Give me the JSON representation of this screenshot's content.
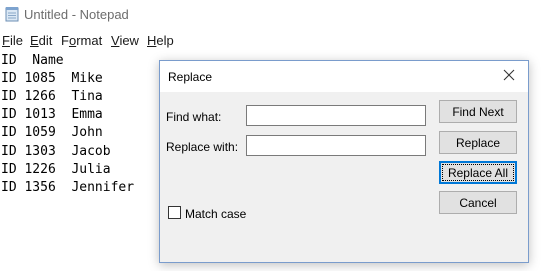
{
  "window": {
    "title": "Untitled - Notepad"
  },
  "menu": {
    "items": [
      "File",
      "Edit",
      "Format",
      "View",
      "Help"
    ],
    "access_keys": [
      "F",
      "E",
      "o",
      "V",
      "H"
    ]
  },
  "editor": {
    "lines": [
      "ID  Name",
      "ID 1085  Mike",
      "ID 1266  Tina",
      "ID 1013  Emma",
      "ID 1059  John",
      "ID 1303  Jacob",
      "ID 1226  Julia",
      "ID 1356  Jennifer"
    ]
  },
  "replace_dialog": {
    "title": "Replace",
    "find_label": "Find what:",
    "find_value": "",
    "replace_label": "Replace with:",
    "replace_value": "",
    "buttons": {
      "find_next": "Find Next",
      "replace": "Replace",
      "replace_all": "Replace All",
      "cancel": "Cancel"
    },
    "match_case_label": "Match case",
    "match_case_checked": false
  },
  "colors": {
    "accent": "#0078d7",
    "dialog_border": "#7a9ccc",
    "dialog_bg": "#f0f0f0",
    "button_bg": "#e1e1e1"
  },
  "icons": {
    "app": "notepad-icon",
    "close": "close-icon"
  }
}
